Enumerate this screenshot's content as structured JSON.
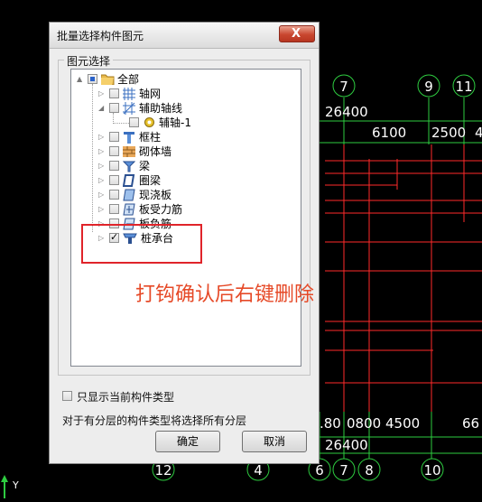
{
  "dialog": {
    "title": "批量选择构件图元",
    "close_glyph": "X",
    "group_title": "图元选择",
    "tree": [
      {
        "id": "root",
        "label": "全部",
        "icon": "folder-icon",
        "expander": "▲",
        "check": "partial"
      },
      {
        "id": "axis-grid",
        "label": "轴网",
        "icon": "grid-icon",
        "expander": "▷",
        "check": "off"
      },
      {
        "id": "aux-axis",
        "label": "辅助轴线",
        "icon": "aux-axis-icon",
        "expander": "◢",
        "check": "off"
      },
      {
        "id": "aux-axis-1",
        "label": "辅轴-1",
        "icon": "gear-icon",
        "expander": "",
        "check": "off"
      },
      {
        "id": "frame-column",
        "label": "框柱",
        "icon": "column-icon",
        "expander": "▷",
        "check": "off"
      },
      {
        "id": "masonry-wall",
        "label": "砌体墙",
        "icon": "wall-icon",
        "expander": "▷",
        "check": "off"
      },
      {
        "id": "beam",
        "label": "梁",
        "icon": "beam-icon",
        "expander": "▷",
        "check": "off"
      },
      {
        "id": "ring-beam",
        "label": "圈梁",
        "icon": "ring-beam-icon",
        "expander": "▷",
        "check": "off"
      },
      {
        "id": "cast-slab",
        "label": "现浇板",
        "icon": "slab-icon",
        "expander": "▷",
        "check": "off"
      },
      {
        "id": "slab-rebar",
        "label": "板受力筋",
        "icon": "rebar-icon",
        "expander": "▷",
        "check": "off"
      },
      {
        "id": "slab-neg-rebar",
        "label": "板负筋",
        "icon": "neg-rebar-icon",
        "expander": "▷",
        "check": "off"
      },
      {
        "id": "pile-cap",
        "label": "桩承台",
        "icon": "pile-cap-icon",
        "expander": "▷",
        "check": "on"
      }
    ],
    "only_current_label": "只显示当前构件类型",
    "only_current_checked": false,
    "note": "对于有分层的构件类型将选择所有分层",
    "ok_label": "确定",
    "cancel_label": "取消"
  },
  "annotation": {
    "text": "打钩确认后右键删除",
    "color": "#e64a28"
  },
  "cad": {
    "top_axes": [
      "7",
      "9",
      "11"
    ],
    "top_dim_main": "26400",
    "top_dims": [
      "6100",
      "2500",
      "4"
    ],
    "bottom_dims": [
      ".80",
      "0800",
      "4500",
      "66"
    ],
    "bottom_dim_main": "26400",
    "bottom_axes": [
      "12",
      "4",
      "6",
      "7",
      "8",
      "10"
    ],
    "ucs_label": "Y",
    "colors": {
      "axis": "#2ecc40",
      "beam": "#ff2a2a",
      "dim_text": "#ffffff"
    }
  }
}
